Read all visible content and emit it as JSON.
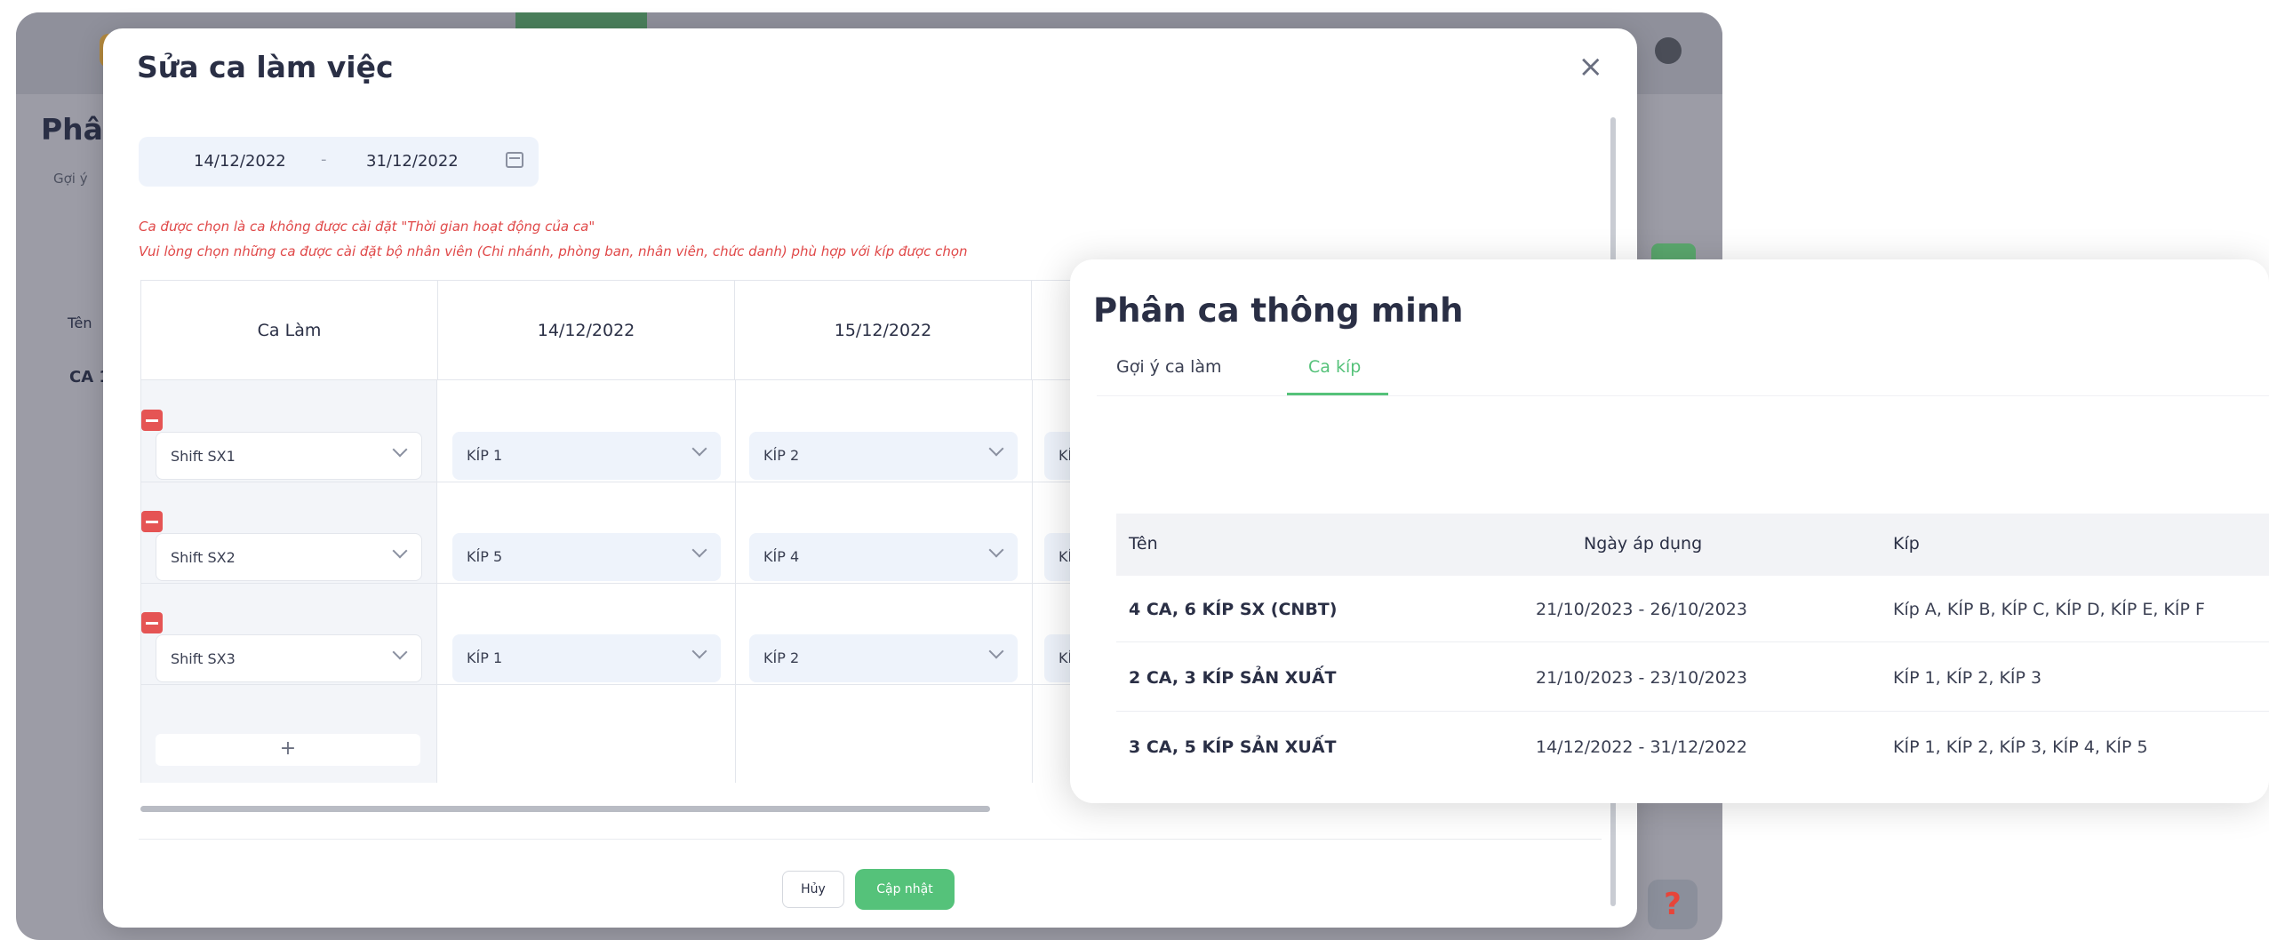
{
  "background": {
    "title": "Phân",
    "subtitle": "Gợi ý",
    "column_header": "Tên",
    "row_label": "CA 1",
    "help_glyph": "?"
  },
  "modal": {
    "title": "Sửa ca làm việc",
    "close_glyph": "×",
    "date_range": {
      "start": "14/12/2022",
      "separator": "-",
      "end": "31/12/2022"
    },
    "warnings": [
      "Ca được chọn là ca không được cài đặt \"Thời gian hoạt động của ca\"",
      "Vui lòng chọn những ca được cài đặt bộ nhân viên (Chi nhánh, phòng ban, nhân viên, chức danh) phù hợp với kíp được chọn"
    ],
    "grid": {
      "headers": [
        "Ca Làm",
        "14/12/2022",
        "15/12/2022"
      ],
      "rows": [
        {
          "shift": "Shift SX1",
          "kips": [
            "KÍP 1",
            "KÍP 2",
            "KÍ"
          ]
        },
        {
          "shift": "Shift SX2",
          "kips": [
            "KÍP 5",
            "KÍP 4",
            "KÍ"
          ]
        },
        {
          "shift": "Shift SX3",
          "kips": [
            "KÍP 1",
            "KÍP 2",
            "KÍ"
          ]
        }
      ],
      "add_label": "+"
    },
    "buttons": {
      "cancel": "Hủy",
      "update": "Cập nhật"
    }
  },
  "popup": {
    "title": "Phân ca thông minh",
    "tabs": [
      {
        "label": "Gợi ý ca làm",
        "active": false
      },
      {
        "label": "Ca kíp",
        "active": true
      }
    ],
    "table": {
      "headers": {
        "name": "Tên",
        "date": "Ngày áp dụng",
        "kip": "Kíp"
      },
      "rows": [
        {
          "name": "4 CA, 6 KÍP SX (CNBT)",
          "date": "21/10/2023 - 26/10/2023",
          "kip": "Kíp A, KÍP B, KÍP C, KÍP D, KÍP E, KÍP F"
        },
        {
          "name": "2 CA, 3 KÍP SẢN XUẤT",
          "date": "21/10/2023 - 23/10/2023",
          "kip": "KÍP 1, KÍP 2, KÍP 3"
        },
        {
          "name": "3 CA, 5 KÍP SẢN XUẤT",
          "date": "14/12/2022 - 31/12/2022",
          "kip": "KÍP 1, KÍP 2, KÍP 3, KÍP 4, KÍP 5"
        }
      ]
    }
  },
  "colors": {
    "accent": "#55c27a",
    "danger": "#e55454",
    "warning_text": "#e04848",
    "text": "#2a2f45"
  }
}
